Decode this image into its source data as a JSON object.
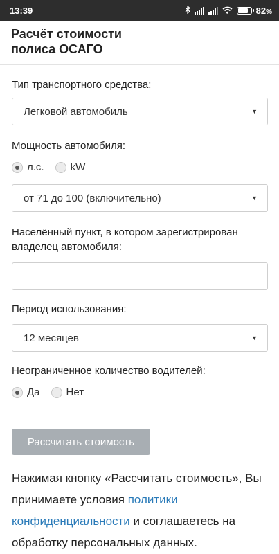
{
  "status_bar": {
    "time": "13:39",
    "battery_percent": "82",
    "battery_suffix": "%",
    "icons": [
      "bluetooth-icon",
      "signal-icon",
      "signal-icon",
      "wifi-icon",
      "battery-icon"
    ]
  },
  "header": {
    "title_line1": "Расчёт стоимости",
    "title_line2": "полиса ОСАГО"
  },
  "form": {
    "vehicle_type": {
      "label": "Тип транспортного средства:",
      "selected": "Легковой автомобиль"
    },
    "power": {
      "label": "Мощность автомобиля:",
      "unit_options": [
        {
          "label": "л.с.",
          "checked": true
        },
        {
          "label": "kW",
          "checked": false
        }
      ],
      "selected": "от 71 до 100 (включительно)"
    },
    "locality": {
      "label_line1": "Населённый пункт, в котором зарегистрирован",
      "label_line2": "владелец автомобиля:",
      "value": "",
      "placeholder": ""
    },
    "period": {
      "label": "Период использования:",
      "selected": "12 месяцев"
    },
    "unlimited_drivers": {
      "label": "Неограниченное количество водителей:",
      "options": [
        {
          "label": "Да",
          "checked": true
        },
        {
          "label": "Нет",
          "checked": false
        }
      ]
    },
    "submit_label": "Рассчитать стоимость"
  },
  "notice": {
    "part1": "Нажимая кнопку «Рассчитать стоимость», Вы принимаете условия ",
    "link": "политики конфиденциальности",
    "part2": " и соглашаетесь на обработку персональных данных."
  },
  "colors": {
    "status_bar_bg": "#2d2d2d",
    "button_disabled": "#a8aeb3",
    "link": "#2b7bb9"
  }
}
